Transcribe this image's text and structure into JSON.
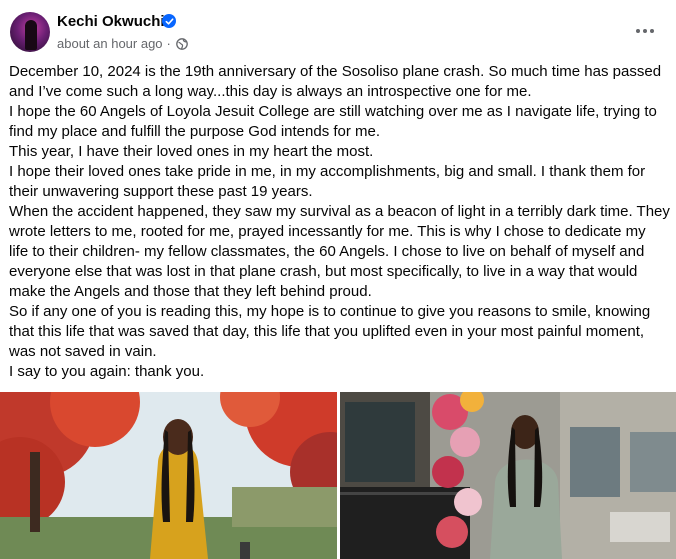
{
  "post": {
    "author": "Kechi Okwuchi",
    "time": "about an hour ago",
    "separator": "·",
    "lines": [
      "December 10, 2024 is the 19th anniversary of the Sosoliso plane crash. So much time has passed",
      "and I’ve come such a long way...this day is always an introspective one for me.",
      "I hope the 60 Angels of Loyola Jesuit College are still watching over me as I navigate life, trying to",
      "find my place and fulfill the purpose God intends for me.",
      "This year, I have their loved ones in my heart the most.",
      "I hope their loved ones take pride in me, in my accomplishments, big and small. I thank them for",
      "their unwavering support these past 19 years.",
      "When the accident happened, they saw my survival as a beacon of light in a terribly dark time. They",
      "wrote letters to me, rooted for me, prayed incessantly for me. This is why I chose to dedicate my",
      "life to their children- my fellow classmates, the 60 Angels. I chose to live on behalf of myself and",
      "everyone else that was lost in that plane crash, but most specifically, to live in a way that would",
      "make the Angels and those that they left behind proud.",
      "So if any one of you is reading this, my hope is to continue to give you reasons to smile, knowing",
      "that this life that was saved that day, this life that you uplifted even in your most painful moment,",
      "was not saved in vain.",
      "I say to you again: thank you."
    ]
  },
  "icons": {
    "verified": "verified-badge-icon",
    "audience": "globe-icon",
    "more": "more-options-icon"
  },
  "colors": {
    "verified_blue": "#0866ff",
    "meta_gray": "#65676b",
    "text": "#050505"
  }
}
